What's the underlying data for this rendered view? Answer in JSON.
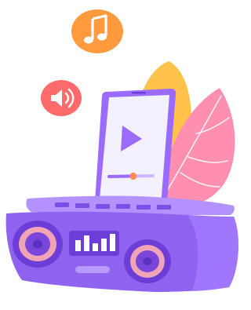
{
  "scene": {
    "description_free": true,
    "palette": {
      "background": "#ffffff",
      "speaker_body": "#8f63f0",
      "speaker_top": "#b391ff",
      "speaker_front": "#7b4fe6",
      "speaker_ring_outer": "#6c3dd7",
      "speaker_ring_inner": "#f2a4b7",
      "speaker_cone": "#7a45d9",
      "display_bars": "#ffffff",
      "handle": "#b89aff",
      "phone_body": "#9b6bff",
      "phone_screen": "#f4f1ff",
      "play_icon": "#9b6bff",
      "progress_track": "#cdb8ff",
      "progress_knob": "#ff8a5c",
      "music_bubble": "#ff9a3d",
      "sound_bubble": "#ff6b6b",
      "leaf_orange": "#ffc24a",
      "leaf_pink": "#ff8fb0",
      "leaf_vein": "#ffffff"
    },
    "icons": {
      "music_note": "music-note-icon",
      "speaker": "volume-icon",
      "play": "play-icon"
    },
    "progress": 0.55
  }
}
